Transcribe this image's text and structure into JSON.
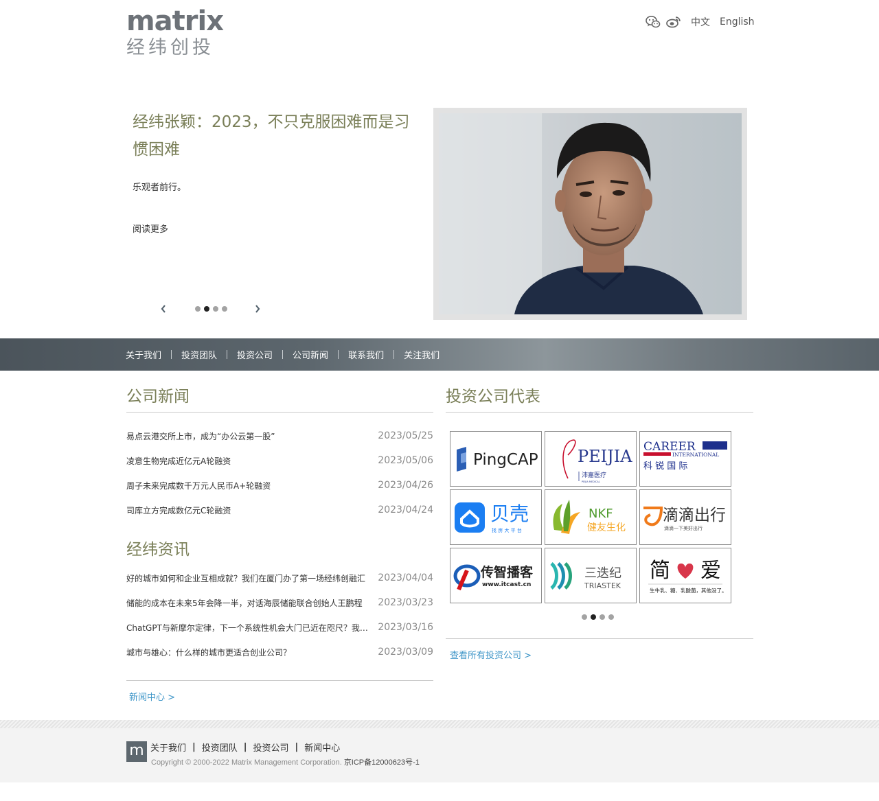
{
  "header": {
    "logo_en": "matrix",
    "logo_cn": "经纬创投",
    "lang_zh": "中文",
    "lang_en": "English"
  },
  "hero": {
    "title": "经纬张颖：2023，不只克服困难而是习惯困难",
    "subtitle": "乐观者前行。",
    "read_more": "阅读更多",
    "slide_count": 4,
    "active_slide": 2
  },
  "nav": {
    "items": [
      {
        "label": "关于我们"
      },
      {
        "label": "投资团队"
      },
      {
        "label": "投资公司"
      },
      {
        "label": "公司新闻"
      },
      {
        "label": "联系我们"
      },
      {
        "label": "关注我们"
      }
    ]
  },
  "company_news": {
    "title": "公司新闻",
    "items": [
      {
        "title": "易点云港交所上市，成为“办公云第一股”",
        "date": "2023/05/25"
      },
      {
        "title": "凌意生物完成近亿元A轮融资",
        "date": "2023/05/06"
      },
      {
        "title": "周子未来完成数千万元人民币A+轮融资",
        "date": "2023/04/26"
      },
      {
        "title": "司库立方完成数亿元C轮融资",
        "date": "2023/04/24"
      }
    ]
  },
  "matrix_info": {
    "title": "经纬资讯",
    "items": [
      {
        "title": "好的城市如何和企业互相成就？我们在厦门办了第一场经纬创融汇",
        "date": "2023/04/04"
      },
      {
        "title": "储能的成本在未来5年会降一半，对话海辰储能联合创始人王鹏程",
        "date": "2023/03/23"
      },
      {
        "title": "ChatGPT与新摩尔定律，下一个系统性机会大门已近在咫尺？我们必须抓住",
        "date": "2023/03/16"
      },
      {
        "title": "城市与雄心：什么样的城市更适合创业公司？",
        "date": "2023/03/09"
      }
    ],
    "more": "新闻中心 >"
  },
  "portfolio": {
    "title": "投资公司代表",
    "logos": [
      {
        "name": "PingCAP",
        "text": "PingCAP"
      },
      {
        "name": "PEIJIA",
        "text": "PEIJIA",
        "sub": "沛嘉医疗",
        "sub2": "PEIJIA MEDICAL"
      },
      {
        "name": "CAREER",
        "text": "CAREER",
        "sub": "INTERNATIONAL",
        "sub2": "科 锐 国 际"
      },
      {
        "name": "beike",
        "text": "贝壳",
        "sub": "找 房 大 平 台"
      },
      {
        "name": "NKF",
        "text": "NKF",
        "sub": "健友生化"
      },
      {
        "name": "didi",
        "text": "滴滴出行",
        "sub": "滴滴一下美好出行"
      },
      {
        "name": "itcast",
        "text": "传智播客",
        "sub": "www.itcast.cn"
      },
      {
        "name": "triastek",
        "text": "三迭纪",
        "sub": "TRIASTEK"
      },
      {
        "name": "jianai",
        "text_left": "简",
        "text_right": "爱",
        "sub": "生牛乳、糖、乳酸菌，其他没了。"
      }
    ],
    "slide_count": 4,
    "active_slide": 2,
    "more": "查看所有投资公司 >"
  },
  "footer": {
    "logo": "m",
    "links": [
      "关于我们",
      "投资团队",
      "投资公司",
      "新闻中心"
    ],
    "copyright": "Copyright © 2000-2022 Matrix Management Corporation.",
    "icp": "京ICP备12000623号-1"
  },
  "colors": {
    "accent_title": "#7a7f58",
    "link": "#3f96c8",
    "nav_bg": "#59636a"
  }
}
